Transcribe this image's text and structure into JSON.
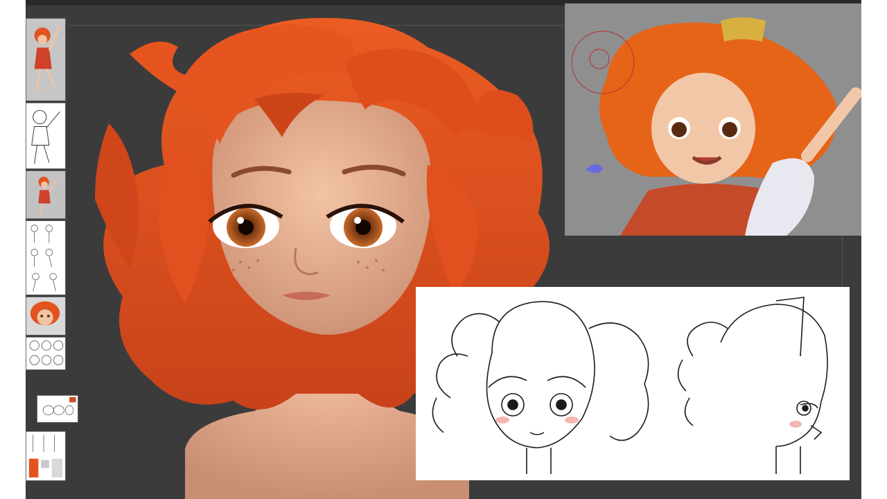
{
  "app": {
    "background_color": "#3b3b3b",
    "skin_color": "#e8b89a",
    "hair_color": "#e2531f"
  },
  "reference_strip": {
    "thumbnails": [
      {
        "name": "color-full-body-ref",
        "icon": "image-thumbnail-icon"
      },
      {
        "name": "sketch-full-body-ref",
        "icon": "image-thumbnail-icon"
      },
      {
        "name": "color-pose-ref",
        "icon": "image-thumbnail-icon"
      },
      {
        "name": "sketch-poses-ref",
        "icon": "image-thumbnail-icon"
      },
      {
        "name": "color-face-ref",
        "icon": "image-thumbnail-icon"
      },
      {
        "name": "sketch-heads-ref",
        "icon": "image-thumbnail-icon"
      },
      {
        "name": "small-sketch-ref",
        "icon": "image-thumbnail-icon"
      },
      {
        "name": "collage-ref",
        "icon": "image-thumbnail-icon"
      }
    ]
  },
  "viewport": {
    "model": "sculpted-head-with-curly-hair"
  },
  "reference_panels": {
    "color": {
      "name": "color-illustration-reference"
    },
    "lineart": {
      "name": "head-turnaround-lineart-reference"
    }
  }
}
